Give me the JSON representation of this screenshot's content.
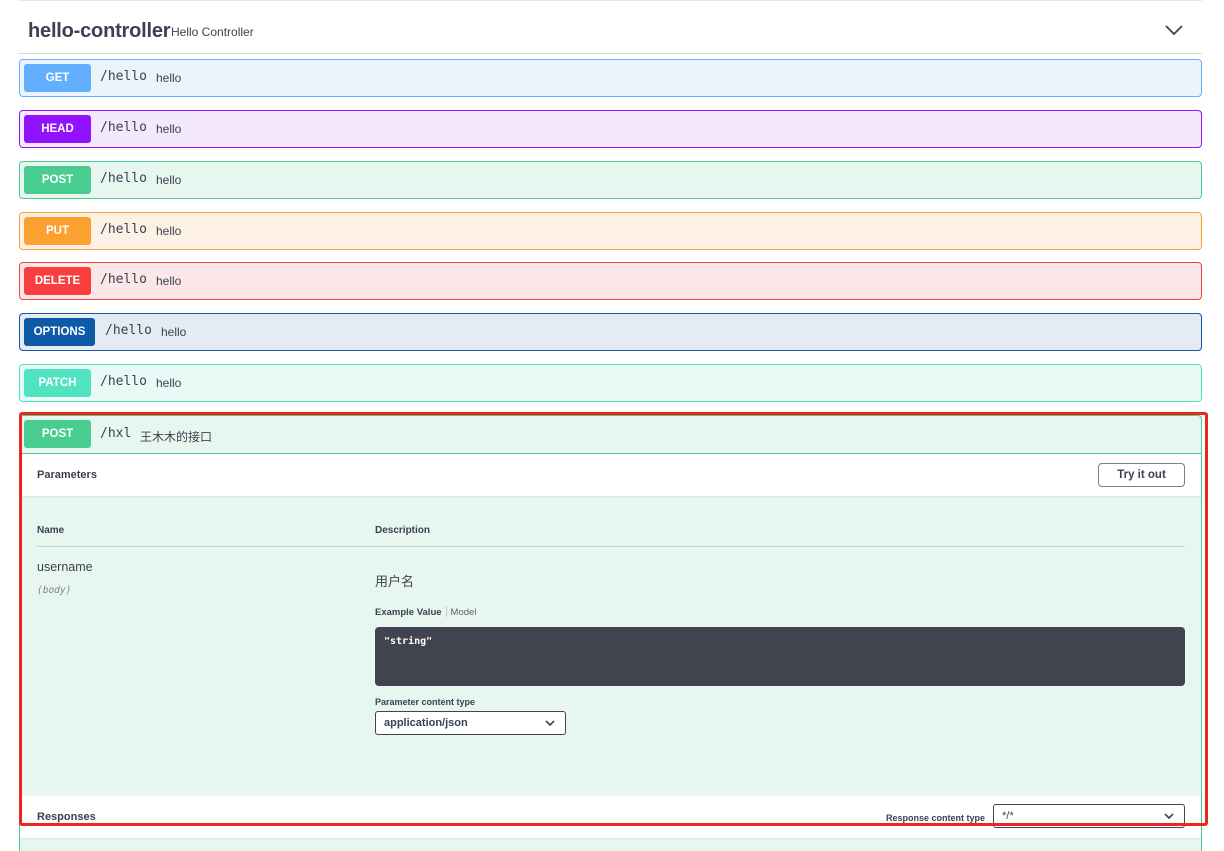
{
  "tag": {
    "name": "hello-controller",
    "description": "Hello Controller"
  },
  "operations": [
    {
      "method": "GET",
      "path": "/hello",
      "summary": "hello"
    },
    {
      "method": "HEAD",
      "path": "/hello",
      "summary": "hello"
    },
    {
      "method": "POST",
      "path": "/hello",
      "summary": "hello"
    },
    {
      "method": "PUT",
      "path": "/hello",
      "summary": "hello"
    },
    {
      "method": "DELETE",
      "path": "/hello",
      "summary": "hello"
    },
    {
      "method": "OPTIONS",
      "path": "/hello",
      "summary": "hello"
    },
    {
      "method": "PATCH",
      "path": "/hello",
      "summary": "hello"
    }
  ],
  "expanded": {
    "method": "POST",
    "path": "/hxl",
    "summary": "王木木的接口",
    "parameters_title": "Parameters",
    "try_it_out": "Try it out",
    "col_name": "Name",
    "col_description": "Description",
    "param": {
      "name": "username",
      "location": "(body)",
      "description": "用户名",
      "tab_example": "Example Value",
      "tab_model": "Model",
      "example": "\"string\"",
      "content_type_label": "Parameter content type",
      "content_type": "application/json"
    },
    "responses_title": "Responses",
    "response_content_type_label": "Response content type",
    "response_content_type": "*/*"
  },
  "colors": {
    "get": "#61affe",
    "head": "#9012fe",
    "post": "#49cc90",
    "put": "#fca130",
    "delete": "#f93e3e",
    "options": "#0d5aa7",
    "patch": "#50e3c2",
    "highlight": "#e8281e"
  }
}
